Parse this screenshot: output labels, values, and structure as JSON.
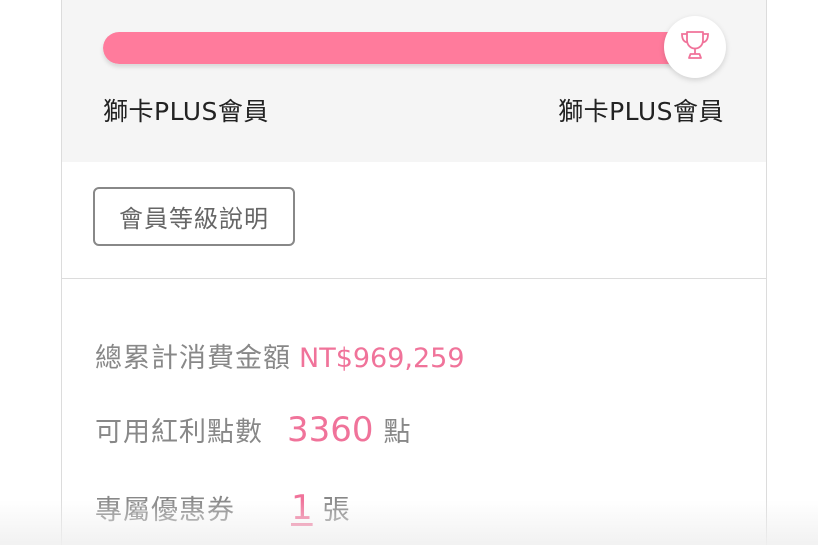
{
  "membership": {
    "progress_fraction": 1.0,
    "current_level": "獅卡PLUS會員",
    "next_level": "獅卡PLUS會員",
    "trophy_icon": "trophy-icon",
    "accent_color": "#ff7b9c"
  },
  "info_button": {
    "label": "會員等級說明"
  },
  "stats": {
    "total_spend_label": "總累計消費金額",
    "total_spend_value": "NT$969,259",
    "points_label": "可用紅利點數",
    "points_value": "3360",
    "points_unit": "點",
    "coupons_label": "專屬優惠券",
    "coupons_value": "1",
    "coupons_unit": "張"
  }
}
